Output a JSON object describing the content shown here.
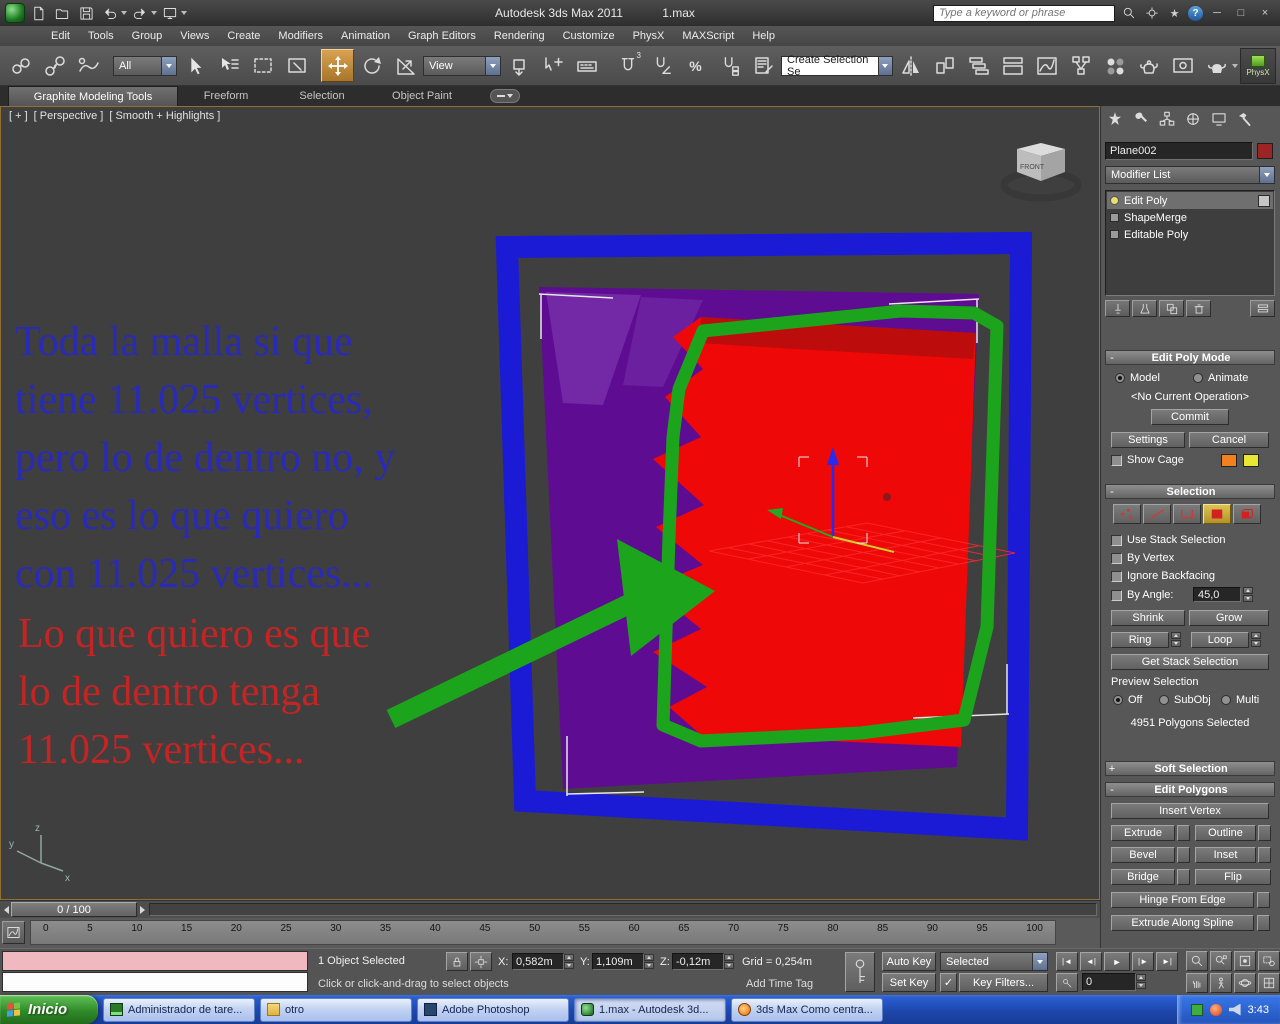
{
  "titlebar": {
    "app_title": "Autodesk 3ds Max  2011",
    "doc_title": "1.max",
    "search_placeholder": "Type a keyword or phrase"
  },
  "menus": [
    "Edit",
    "Tools",
    "Group",
    "Views",
    "Create",
    "Modifiers",
    "Animation",
    "Graph Editors",
    "Rendering",
    "Customize",
    "PhysX",
    "MAXScript",
    "Help"
  ],
  "toolbar": {
    "filter_value": "All",
    "view_value": "View",
    "selection_set_value": "Create Selection Se",
    "snap_label": "3",
    "physx_label": "PhysX"
  },
  "ribbon": {
    "tabs": [
      "Graphite Modeling Tools",
      "Freeform",
      "Selection",
      "Object Paint"
    ]
  },
  "viewport": {
    "label_general": "[ + ]",
    "label_view": "[ Perspective ]",
    "label_shading": "[ Smooth + Highlights ]",
    "viewcube_label": "FRONT",
    "axis": {
      "x": "x",
      "y": "y",
      "z": "z"
    },
    "annotation_blue_lines": [
      "Toda la malla si que",
      "tiene 11.025 vertices,",
      "pero lo de dentro no, y",
      "eso es lo que quiero",
      "con 11.025 vertices..."
    ],
    "annotation_red_lines": [
      "Lo que quiero es que",
      "lo de dentro tenga",
      "11.025 vertices..."
    ]
  },
  "command_panel": {
    "object_name": "Plane002",
    "modifier_list_label": "Modifier List",
    "stack": [
      {
        "label": "Edit Poly"
      },
      {
        "label": "ShapeMerge"
      },
      {
        "label": "Editable Poly"
      }
    ],
    "edit_poly_mode": {
      "title": "Edit Poly Mode",
      "model": "Model",
      "animate": "Animate",
      "operation": "<No Current Operation>",
      "commit": "Commit",
      "settings": "Settings",
      "cancel": "Cancel",
      "show_cage": "Show Cage"
    },
    "selection": {
      "title": "Selection",
      "use_stack_selection": "Use Stack Selection",
      "by_vertex": "By Vertex",
      "ignore_backfacing": "Ignore Backfacing",
      "by_angle": "By Angle:",
      "by_angle_value": "45,0",
      "shrink": "Shrink",
      "grow": "Grow",
      "ring": "Ring",
      "loop": "Loop",
      "get_stack_selection": "Get Stack Selection",
      "preview_selection": "Preview Selection",
      "off": "Off",
      "subobj": "SubObj",
      "multi": "Multi",
      "status": "4951 Polygons Selected"
    },
    "soft_selection_title": "Soft Selection",
    "edit_polygons": {
      "title": "Edit Polygons",
      "insert_vertex": "Insert Vertex",
      "extrude": "Extrude",
      "outline": "Outline",
      "bevel": "Bevel",
      "inset": "Inset",
      "bridge": "Bridge",
      "flip": "Flip",
      "hinge_from_edge": "Hinge From Edge",
      "extrude_along_spline": "Extrude Along Spline"
    }
  },
  "timeline": {
    "slider_value": "0 / 100",
    "ticks": [
      "0",
      "5",
      "10",
      "15",
      "20",
      "25",
      "30",
      "35",
      "40",
      "45",
      "50",
      "55",
      "60",
      "65",
      "70",
      "75",
      "80",
      "85",
      "90",
      "95",
      "100"
    ]
  },
  "status_bar": {
    "selection_status": "1 Object Selected",
    "prompt": "Click or click-and-drag to select objects",
    "x_label": "X:",
    "x_value": "0,582m",
    "y_label": "Y:",
    "y_value": "1,109m",
    "z_label": "Z:",
    "z_value": "-0,12m",
    "grid_value": "Grid = 0,254m",
    "add_time_tag": "Add Time Tag",
    "auto_key": "Auto Key",
    "set_key": "Set Key",
    "key_mode_value": "Selected",
    "key_filters": "Key Filters...",
    "frame_value": "0"
  },
  "taskbar": {
    "start_label": "Inicio",
    "buttons": [
      "Administrador de tare...",
      "otro",
      "Adobe Photoshop",
      "1.max - Autodesk 3d...",
      "3ds Max Como centra..."
    ],
    "clock": "3:43"
  },
  "icons": {
    "minimize": "─",
    "maximize": "□",
    "close": "×",
    "help": "?",
    "star": "★",
    "collapse": "-",
    "expand": "+",
    "check": "✓",
    "percent": "%",
    "go_start": "|◄",
    "step_back": "◄|",
    "play": "►",
    "step_fwd": "|►",
    "go_end": "►|",
    "caret": "▾"
  },
  "colors": {
    "viewport_purple": "#5e0c92",
    "viewport_red": "#ee0808",
    "viewport_blue": "#1b1bd6",
    "viewport_green": "#1da41d",
    "annotation_blue": "#2a2ab8",
    "annotation_red": "#c42424",
    "active_tool_orange": "#c8892f",
    "taskbar_blue": "#1d47ab"
  }
}
